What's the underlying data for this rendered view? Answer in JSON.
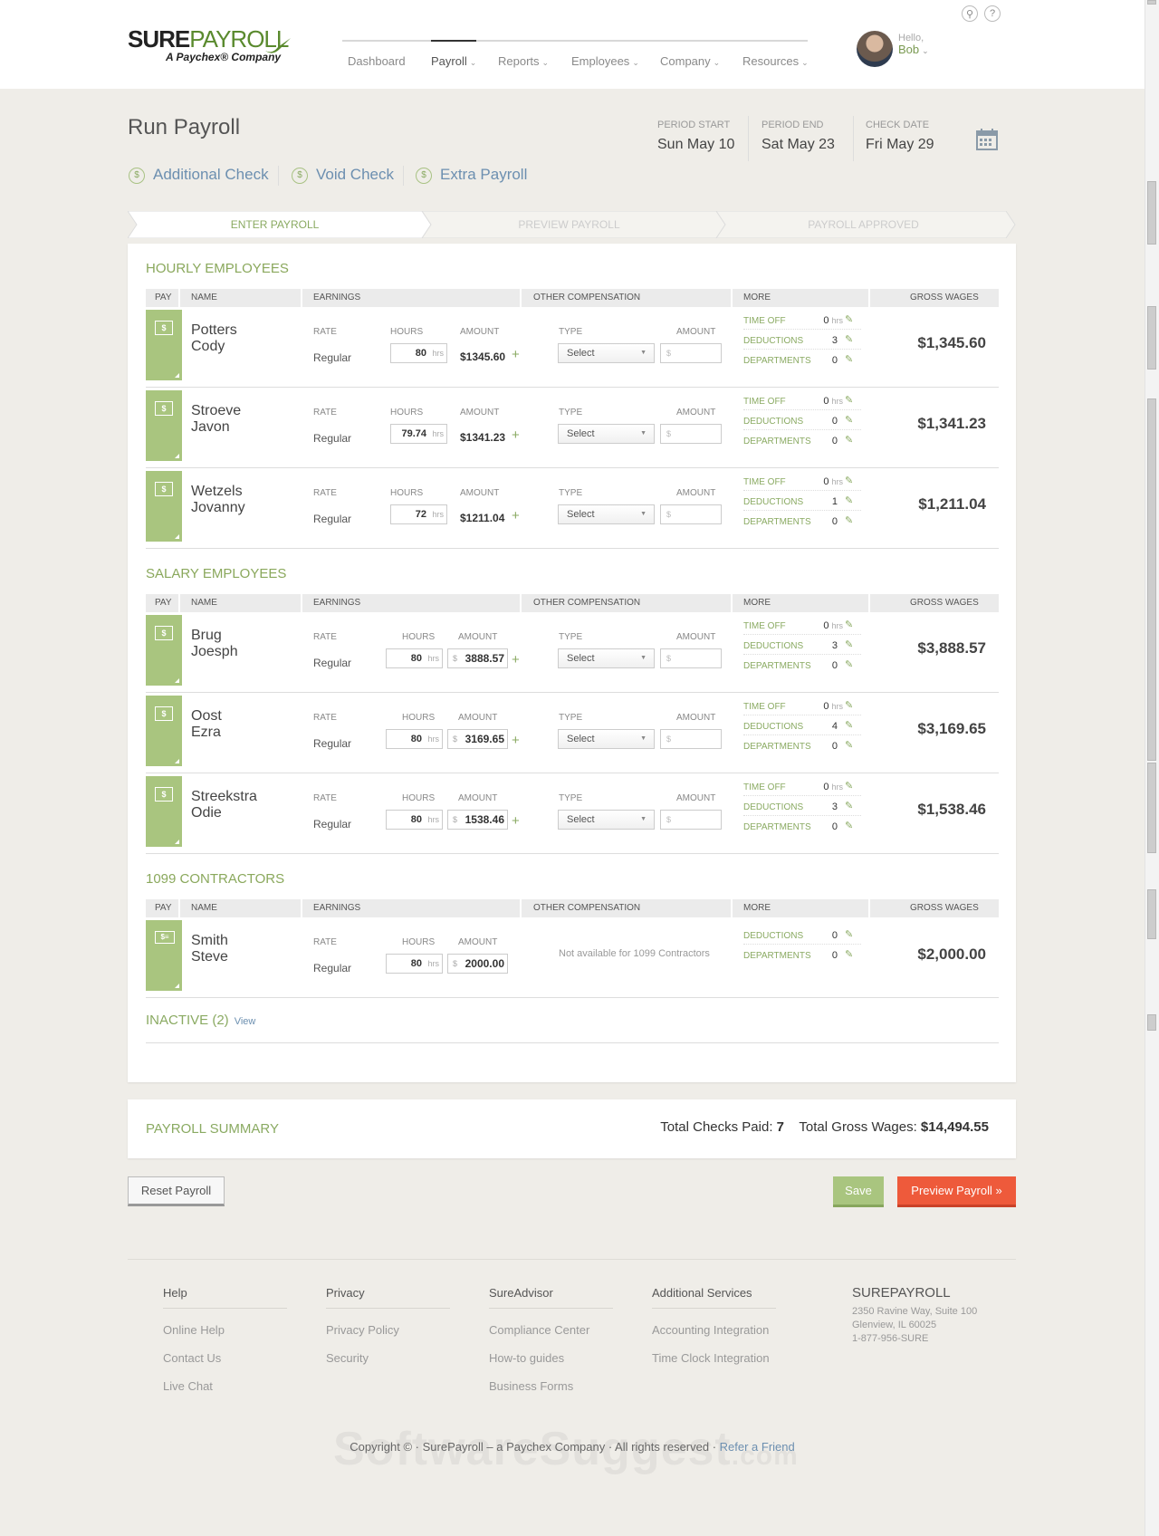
{
  "brand": {
    "main_b": "SURE",
    "main_p": "PAYROLL",
    "sub": "A Paychex® Company"
  },
  "nav": [
    {
      "label": "Dashboard",
      "dropdown": false,
      "active": false
    },
    {
      "label": "Payroll",
      "dropdown": true,
      "active": true
    },
    {
      "label": "Reports",
      "dropdown": true,
      "active": false
    },
    {
      "label": "Employees",
      "dropdown": true,
      "active": false
    },
    {
      "label": "Company",
      "dropdown": true,
      "active": false
    },
    {
      "label": "Resources",
      "dropdown": true,
      "active": false
    }
  ],
  "user": {
    "hello": "Hello,",
    "name": "Bob"
  },
  "page": {
    "title": "Run Payroll"
  },
  "period": [
    {
      "label": "Period Start",
      "value": "Sun May 10"
    },
    {
      "label": "Period End",
      "value": "Sat May 23"
    },
    {
      "label": "Check Date",
      "value": "Fri May 29"
    }
  ],
  "actions": [
    {
      "label": "Additional Check",
      "icon": "dollar-circle-icon"
    },
    {
      "label": "Void Check",
      "icon": "dollar-circle-icon"
    },
    {
      "label": "Extra Payroll",
      "icon": "dollar-circle-icon"
    }
  ],
  "steps": [
    {
      "label": "ENTER PAYROLL",
      "active": true
    },
    {
      "label": "PREVIEW PAYROLL",
      "active": false
    },
    {
      "label": "PAYROLL APPROVED",
      "active": false
    }
  ],
  "columns": {
    "pay": "PAY",
    "name": "NAME",
    "earnings": "EARNINGS",
    "other": "OTHER COMPENSATION",
    "more": "MORE",
    "gross": "GROSS WAGES",
    "rate": "RATE",
    "hours": "HOURS",
    "amount": "AMOUNT",
    "type": "TYPE",
    "amount2": "AMOUNT",
    "time_off": "TIME OFF",
    "deductions": "DEDUCTIONS",
    "departments": "DEPARTMENTS",
    "select": "Select",
    "dollar": "$",
    "hrs": "hrs",
    "plus": "+"
  },
  "hourly": {
    "title": "HOURLY EMPLOYEES",
    "rows": [
      {
        "last": "Potters",
        "first": "Cody",
        "rate": "Regular",
        "hours": "80",
        "amount": "$1345.60",
        "time_off": "0",
        "deductions": "3",
        "departments": "0",
        "gross": "$1,345.60"
      },
      {
        "last": "Stroeve",
        "first": "Javon",
        "rate": "Regular",
        "hours": "79.74",
        "amount": "$1341.23",
        "time_off": "0",
        "deductions": "0",
        "departments": "0",
        "gross": "$1,341.23"
      },
      {
        "last": "Wetzels",
        "first": "Jovanny",
        "rate": "Regular",
        "hours": "72",
        "amount": "$1211.04",
        "time_off": "0",
        "deductions": "1",
        "departments": "0",
        "gross": "$1,211.04"
      }
    ]
  },
  "salary": {
    "title": "SALARY EMPLOYEES",
    "rows": [
      {
        "last": "Brug",
        "first": "Joesph",
        "rate": "Regular",
        "hours": "80",
        "amount": "3888.57",
        "time_off": "0",
        "deductions": "3",
        "departments": "0",
        "gross": "$3,888.57"
      },
      {
        "last": "Oost",
        "first": "Ezra",
        "rate": "Regular",
        "hours": "80",
        "amount": "3169.65",
        "time_off": "0",
        "deductions": "4",
        "departments": "0",
        "gross": "$3,169.65"
      },
      {
        "last": "Streekstra",
        "first": "Odie",
        "rate": "Regular",
        "hours": "80",
        "amount": "1538.46",
        "time_off": "0",
        "deductions": "3",
        "departments": "0",
        "gross": "$1,538.46"
      }
    ]
  },
  "contractors": {
    "title": "1099 CONTRACTORS",
    "na": "Not available for 1099 Contractors",
    "rows": [
      {
        "last": "Smith",
        "first": "Steve",
        "rate": "Regular",
        "hours": "80",
        "amount": "2000.00",
        "deductions": "0",
        "departments": "0",
        "gross": "$2,000.00"
      }
    ]
  },
  "inactive": {
    "label": "INACTIVE (2)",
    "link": "View"
  },
  "summary": {
    "title": "PAYROLL SUMMARY",
    "checks_label": "Total Checks Paid:",
    "checks": "7",
    "gross_label": "Total Gross Wages:",
    "gross": "$14,494.55"
  },
  "buttons": {
    "reset": "Reset Payroll",
    "save": "Save",
    "preview": "Preview Payroll »"
  },
  "footer": {
    "cols": [
      {
        "title": "Help",
        "links": [
          "Online Help",
          "Contact Us",
          "Live Chat"
        ]
      },
      {
        "title": "Privacy",
        "links": [
          "Privacy Policy",
          "Security"
        ]
      },
      {
        "title": "SureAdvisor",
        "links": [
          "Compliance Center",
          "How-to guides",
          "Business Forms"
        ]
      },
      {
        "title": "Additional Services",
        "links": [
          "Accounting Integration",
          "Time Clock Integration"
        ]
      }
    ],
    "company": {
      "name": "SUREPAYROLL",
      "address1": "2350 Ravine Way, Suite 100",
      "address2": "Glenview, IL 60025",
      "phone": "1-877-956-SURE"
    },
    "copyright": "Copyright © · SurePayroll – a Paychex Company · All rights reserved ·",
    "refer": "Refer a Friend"
  },
  "watermark": {
    "text": "SoftwareSuggest",
    "suffix": ".com"
  },
  "colors": {
    "accent_green": "#a9c57f",
    "link_blue": "#6c8fb0",
    "preview_orange": "#ee5a3b"
  }
}
